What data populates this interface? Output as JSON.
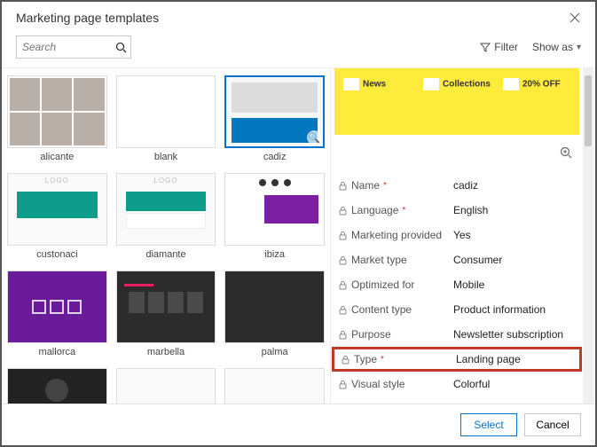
{
  "dialog": {
    "title": "Marketing page templates"
  },
  "toolbar": {
    "search_placeholder": "Search",
    "filter_label": "Filter",
    "showas_label": "Show as"
  },
  "templates": [
    {
      "name": "alicante"
    },
    {
      "name": "blank"
    },
    {
      "name": "cadiz",
      "selected": true
    },
    {
      "name": "custonaci"
    },
    {
      "name": "diamante"
    },
    {
      "name": "ibiza"
    },
    {
      "name": "mallorca"
    },
    {
      "name": "marbella"
    },
    {
      "name": "palma"
    }
  ],
  "preview": {
    "cols": [
      "News",
      "Collections",
      "20% OFF"
    ]
  },
  "details": {
    "rows": [
      {
        "label": "Name",
        "value": "cadiz",
        "required": true
      },
      {
        "label": "Language",
        "value": "English",
        "required": true
      },
      {
        "label": "Marketing provided",
        "value": "Yes"
      },
      {
        "label": "Market type",
        "value": "Consumer"
      },
      {
        "label": "Optimized for",
        "value": "Mobile"
      },
      {
        "label": "Content type",
        "value": "Product information"
      },
      {
        "label": "Purpose",
        "value": "Newsletter subscription"
      },
      {
        "label": "Type",
        "value": "Landing page",
        "required": true,
        "highlight": true
      },
      {
        "label": "Visual style",
        "value": "Colorful"
      }
    ]
  },
  "footer": {
    "select": "Select",
    "cancel": "Cancel"
  },
  "misc": {
    "logo": "LOGO"
  }
}
